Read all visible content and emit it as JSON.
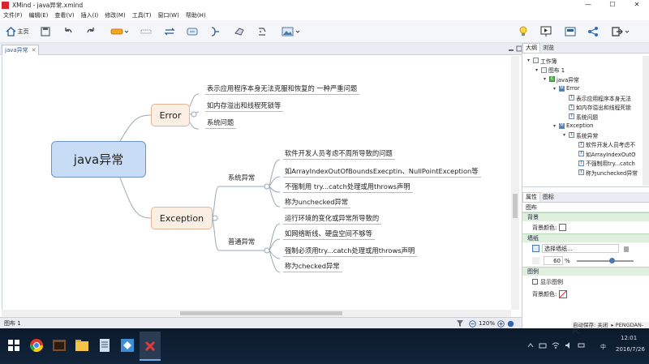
{
  "window": {
    "title": "XMind - java异常.xmind",
    "controls": [
      "—",
      "☐",
      "✕"
    ]
  },
  "menu": [
    "文件(F)",
    "编辑(E)",
    "查看(V)",
    "插入(I)",
    "修改(M)",
    "工具(T)",
    "窗口(W)",
    "帮助(H)"
  ],
  "toolbar": {
    "home_label": "主页"
  },
  "editor": {
    "tab_label": "java异常",
    "tab_close": "✕"
  },
  "mindmap": {
    "central": "java异常",
    "error": {
      "label": "Error",
      "children": [
        "表示应用程序本身无法克服和恢复的 一种严重问题",
        "如内存溢出和线程死锁等",
        "系统问题"
      ]
    },
    "exception": {
      "label": "Exception",
      "groups": [
        {
          "label": "系统异常",
          "children": [
            "软件开发人员考虑不周所导致的问题",
            "如ArrayIndexOutOfBoundsExecptin、NullPointException等",
            "不强制用 try...catch处理或用throws声明",
            "称为unchecked异常"
          ]
        },
        {
          "label": "普通异常",
          "children": [
            "运行环境的变化或异常所导致的",
            "如网络断线、硬盘空间不够等",
            "强制必须用try...catch处理或用throws声明",
            "称为checked异常"
          ]
        }
      ]
    }
  },
  "status": {
    "sheet_tab": "图布 1",
    "zoom": "120%"
  },
  "outline_panel": {
    "tabs": [
      "大纲",
      "浏览"
    ],
    "rows": [
      {
        "label": "工作簿",
        "level": 0,
        "icon": "folder"
      },
      {
        "label": "图布 1",
        "level": 1,
        "icon": "sheet"
      },
      {
        "label": "java异常",
        "level": 2,
        "icon": "C"
      },
      {
        "label": "Error",
        "level": 3,
        "icon": "M"
      },
      {
        "label": "表示应用程序本身无法",
        "level": 4,
        "icon": "T"
      },
      {
        "label": "如内存溢出和线程死锁",
        "level": 4,
        "icon": "T"
      },
      {
        "label": "系统问题",
        "level": 4,
        "icon": "T"
      },
      {
        "label": "Exception",
        "level": 3,
        "icon": "M"
      },
      {
        "label": "系统异常",
        "level": 4,
        "icon": "T"
      },
      {
        "label": "软件开发人员考虑不",
        "level": 5,
        "icon": "T"
      },
      {
        "label": "如ArrayIndexOutO",
        "level": 5,
        "icon": "T"
      },
      {
        "label": "不强制用try...catch",
        "level": 5,
        "icon": "T"
      },
      {
        "label": "称为unchecked异常",
        "level": 5,
        "icon": "T"
      }
    ]
  },
  "properties_panel": {
    "tabs": [
      "属性",
      "图标"
    ],
    "header": "图布",
    "bg_section": "背景",
    "bg_color_label": "背景颜色:",
    "wallpaper_section": "墙纸",
    "wallpaper_select": "选择墙纸...",
    "opacity_value": "60",
    "opacity_unit": "%",
    "legend_section": "图例",
    "show_legend_label": "显示图例",
    "legend_bg_label": "背景颜色:"
  },
  "taskbar": {
    "autosave": "自动保存: 关闭",
    "user": "PENGDAN-PC",
    "time": "12:01",
    "date": "2016/7/26",
    "ime": "中"
  }
}
